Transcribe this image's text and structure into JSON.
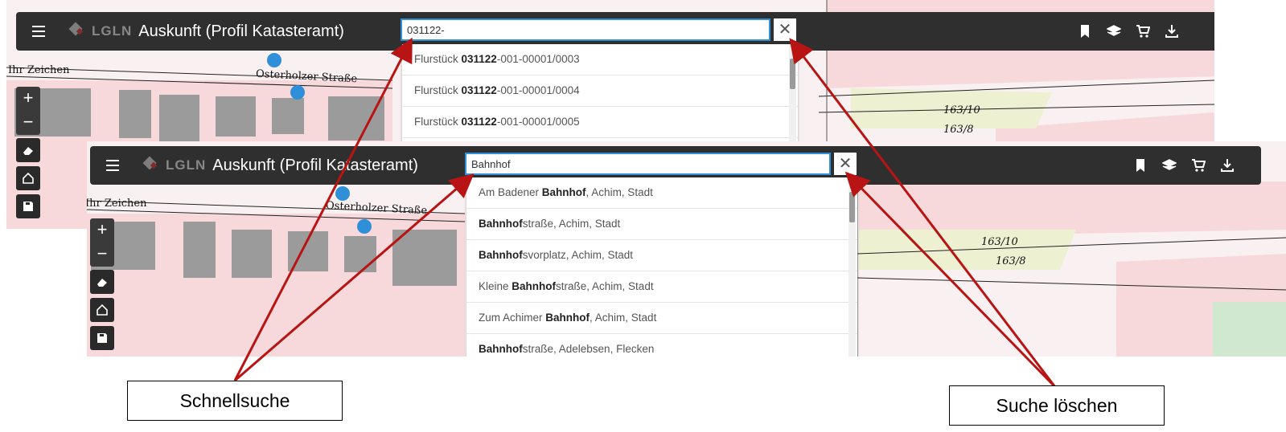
{
  "panel1": {
    "app_title": "Auskunft (Profil Katasteramt)",
    "logo_text": "LGLN",
    "search_value": "031122-",
    "map_labels": {
      "street": "Osterholzer Straße",
      "zeichen": "Ihr Zeichen",
      "parcel_a": "163/10",
      "parcel_b": "163/8"
    },
    "results": [
      {
        "prefix": "Flurstück ",
        "bold": "031122",
        "suffix": "-001-00001/0003"
      },
      {
        "prefix": "Flurstück ",
        "bold": "031122",
        "suffix": "-001-00001/0004"
      },
      {
        "prefix": "Flurstück ",
        "bold": "031122",
        "suffix": "-001-00001/0005"
      }
    ]
  },
  "panel2": {
    "app_title": "Auskunft (Profil Katasteramt)",
    "logo_text": "LGLN",
    "search_value": "Bahnhof",
    "map_labels": {
      "street": "Osterholzer Straße",
      "zeichen": "Ihr Zeichen",
      "parcel_a": "163/10",
      "parcel_b": "163/8"
    },
    "results": [
      {
        "prefix": "Am Badener ",
        "bold": "Bahnhof",
        "suffix": ", Achim, Stadt"
      },
      {
        "prefix": "",
        "bold": "Bahnhof",
        "suffix": "straße, Achim, Stadt"
      },
      {
        "prefix": "",
        "bold": "Bahnhof",
        "suffix": "svorplatz, Achim, Stadt"
      },
      {
        "prefix": "Kleine ",
        "bold": "Bahnhof",
        "suffix": "straße, Achim, Stadt"
      },
      {
        "prefix": "Zum Achimer ",
        "bold": "Bahnhof",
        "suffix": ", Achim, Stadt"
      },
      {
        "prefix": "",
        "bold": "Bahnhof",
        "suffix": "straße, Adelebsen, Flecken"
      }
    ]
  },
  "controls": {
    "zoom_in": "+",
    "zoom_out": "−",
    "clear_symbol": "✕"
  },
  "icons": [
    "menu-icon",
    "bookmark-icon",
    "layers-icon",
    "cart-icon",
    "download-icon",
    "eraser-icon",
    "home-icon",
    "save-icon"
  ],
  "callouts": {
    "quick_search": "Schnellsuche",
    "clear_search": "Suche löschen"
  },
  "colors": {
    "toolbar": "#2f2f2f",
    "search_border": "#2f8fd8",
    "arrow": "#b81414",
    "parcel_fill": "#f7d9dc",
    "building": "#9b9b9b"
  }
}
